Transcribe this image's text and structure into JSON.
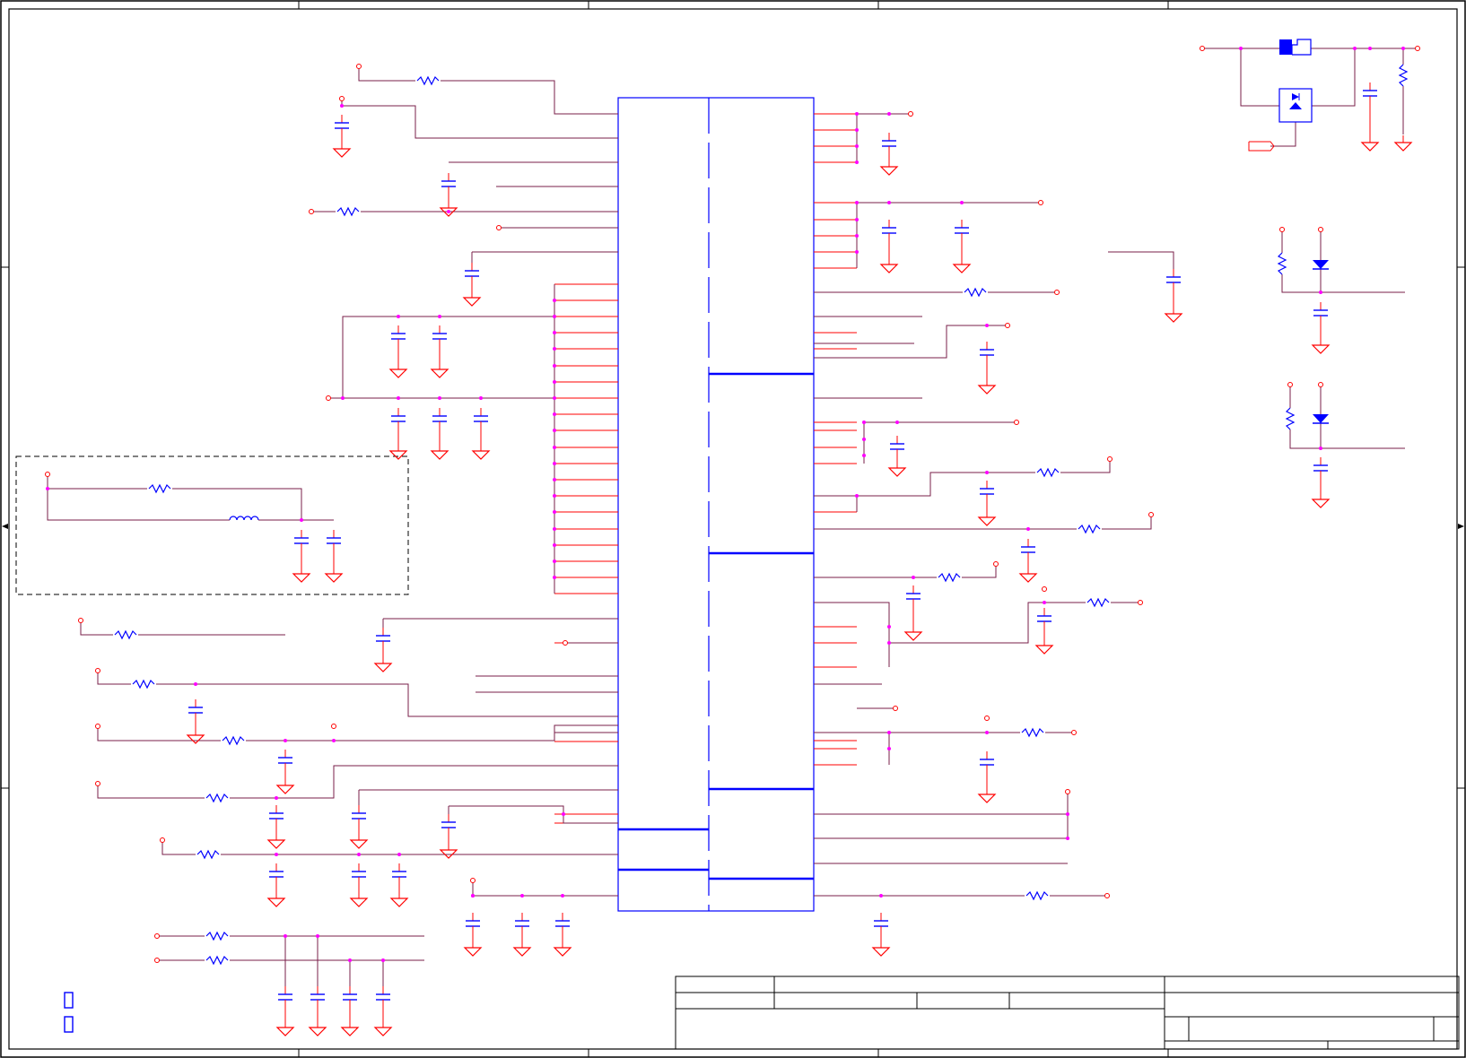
{
  "sheet": {
    "title_block": {
      "title": "",
      "size": "",
      "document_number": "",
      "revision": "",
      "date": "",
      "sheet_of": ""
    },
    "border_zone_labels": []
  },
  "colors": {
    "wire": "#7a1f4a",
    "net_stub": "#ff0000",
    "symbol": "#0000ff",
    "junction": "#ff00ff",
    "border": "#000000",
    "dashed_box": "#000000"
  },
  "legend": {
    "items": [
      {
        "icon": "box-symbol-icon",
        "label": ""
      },
      {
        "icon": "box-symbol-icon",
        "label": ""
      }
    ]
  }
}
